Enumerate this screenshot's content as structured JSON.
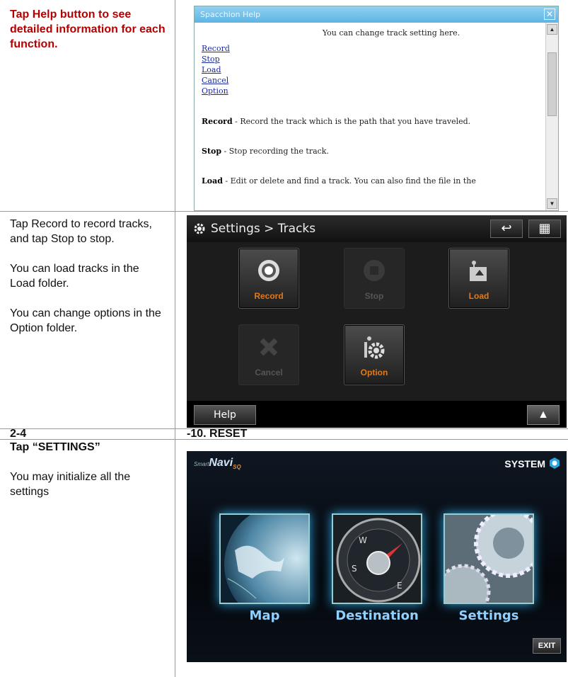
{
  "row1": {
    "instruction": "Tap Help button to see detailed information for each function."
  },
  "help_window": {
    "title": "Spacchion Help",
    "intro": "You can change track setting here.",
    "links": [
      "Record",
      "Stop",
      "Load",
      "Cancel",
      "Option"
    ],
    "paragraphs": [
      {
        "term": "Record",
        "text": " - Record the track which is the path that you have traveled."
      },
      {
        "term": "Stop",
        "text": " - Stop recording the track."
      },
      {
        "term": "Load",
        "text": " - Edit or delete and find a track. You can also find the file in the"
      }
    ]
  },
  "row2": {
    "p1": "Tap Record to record tracks, and tap Stop to stop.",
    "p2": "You can load tracks in the Load folder.",
    "p3": "You can change options in the Option folder."
  },
  "tracks_screen": {
    "header": "Settings > Tracks",
    "tiles": [
      {
        "label": "Record",
        "enabled": true
      },
      {
        "label": "Stop",
        "enabled": false
      },
      {
        "label": "Load",
        "enabled": true
      },
      {
        "label": "Cancel",
        "enabled": false
      },
      {
        "label": "Option",
        "enabled": true
      }
    ],
    "help_button": "Help",
    "accent": "#e07a1a"
  },
  "section": {
    "number": "2-4",
    "title": "-10. RESET"
  },
  "row4": {
    "instruction": "Tap “SETTINGS”",
    "note": "You may initialize all the settings"
  },
  "menu_screen": {
    "logo_prefix": "Smart",
    "logo_main": "Navi",
    "logo_suffix": "SQ",
    "system_label": "SYSTEM",
    "items": [
      "Map",
      "Destination",
      "Settings"
    ],
    "exit_label": "EXIT",
    "accent": "#8fd0ff"
  }
}
